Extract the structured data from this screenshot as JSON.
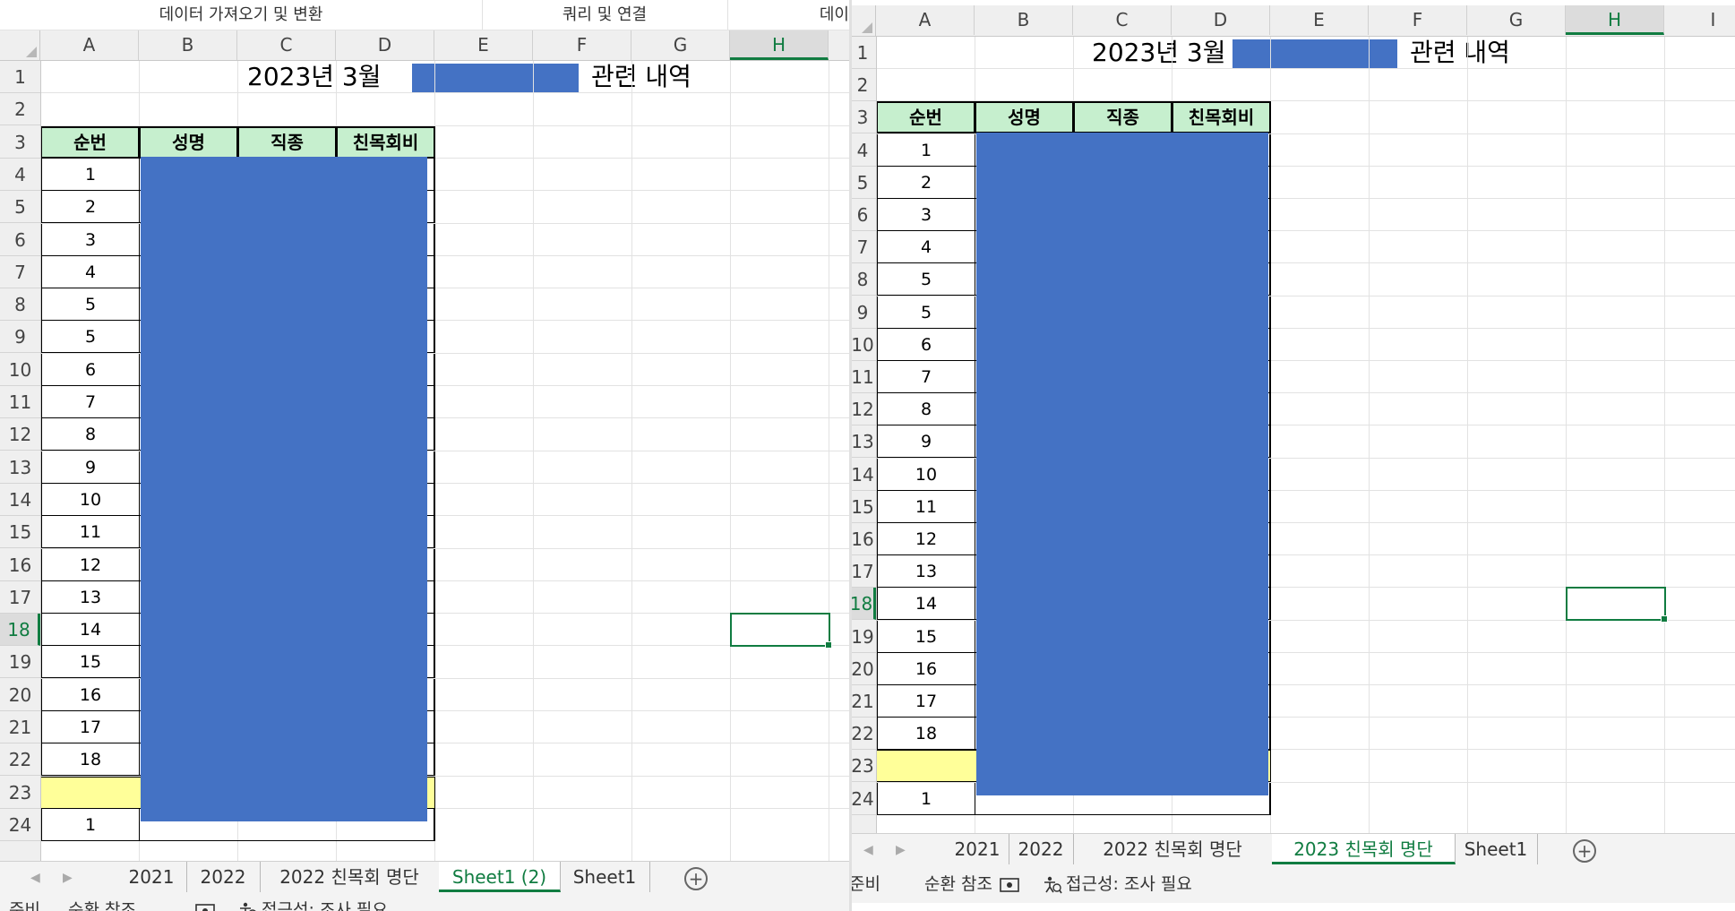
{
  "left": {
    "ribbon_groups": [
      "데이터 가져오기 및 변환",
      "쿼리 및 연결",
      "데이"
    ],
    "columns": [
      "A",
      "B",
      "C",
      "D",
      "E",
      "F",
      "G",
      "H"
    ],
    "selected_column": "H",
    "rows": [
      "1",
      "2",
      "3",
      "4",
      "5",
      "6",
      "7",
      "8",
      "9",
      "10",
      "11",
      "12",
      "13",
      "14",
      "15",
      "16",
      "17",
      "18",
      "19",
      "20",
      "21",
      "22",
      "23",
      "24"
    ],
    "selected_row": "18",
    "title_prefix": "2023년 3월",
    "title_suffix": "관련 내역",
    "headers": [
      "순번",
      "성명",
      "직종",
      "친목회비"
    ],
    "serials": [
      "1",
      "2",
      "3",
      "4",
      "5",
      "5",
      "6",
      "7",
      "8",
      "9",
      "10",
      "11",
      "12",
      "13",
      "14",
      "15",
      "16",
      "17",
      "18",
      "",
      "1"
    ],
    "tabs": [
      "2021",
      "2022",
      "2022 친목회 명단",
      "Sheet1 (2)",
      "Sheet1"
    ],
    "active_tab": "Sheet1 (2)",
    "status": [
      "준비",
      "순환 참조",
      "접근성: 조사 필요"
    ]
  },
  "right": {
    "columns": [
      "A",
      "B",
      "C",
      "D",
      "E",
      "F",
      "G",
      "H",
      "I"
    ],
    "selected_column": "H",
    "rows": [
      "1",
      "2",
      "3",
      "4",
      "5",
      "6",
      "7",
      "8",
      "9",
      "10",
      "11",
      "12",
      "13",
      "14",
      "15",
      "16",
      "17",
      "18",
      "19",
      "20",
      "21",
      "22",
      "23",
      "24"
    ],
    "selected_row": "18",
    "title_prefix": "2023년 3월 학",
    "title_suffix": "관련 내역",
    "headers": [
      "순번",
      "성명",
      "직종",
      "친목회비"
    ],
    "serials": [
      "1",
      "2",
      "3",
      "4",
      "5",
      "5",
      "6",
      "7",
      "8",
      "9",
      "10",
      "11",
      "12",
      "13",
      "14",
      "15",
      "16",
      "17",
      "18",
      "",
      "1"
    ],
    "tabs": [
      "2021",
      "2022",
      "2022 친목회 명단",
      "2023 친목회 명단",
      "Sheet1"
    ],
    "active_tab": "2023 친목회 명단",
    "status": [
      "준비",
      "순환 참조",
      "접근성: 조사 필요"
    ]
  },
  "colors": {
    "header_fill": "#c6efce",
    "highlight_row_fill": "#ffff99",
    "redaction": "#4472c4",
    "excel_green": "#107c41"
  }
}
